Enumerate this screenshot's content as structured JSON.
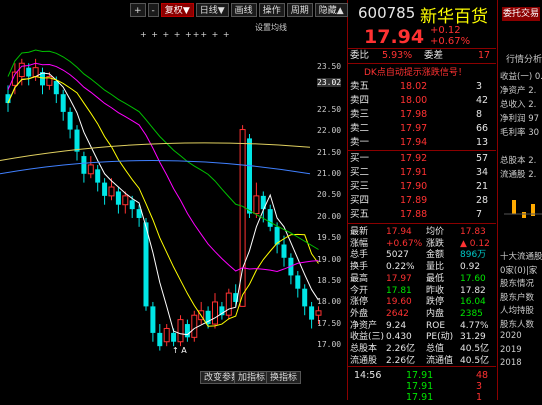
{
  "toolbar": {
    "plus": "+",
    "minus": "-",
    "adjust": "复权",
    "period": "日线",
    "overlay": "画线",
    "ops": "操作",
    "period2": "周期",
    "dropdown_arrow": "▼",
    "more": "隐藏",
    "more_arrow": "▲"
  },
  "chart": {
    "setting_label": "设置均线",
    "prices": [
      "23.50",
      "23.02",
      "22.50",
      "22.00",
      "21.50",
      "21.00",
      "20.50",
      "20.00",
      "19.50",
      "19.00",
      "18.50",
      "18.00",
      "17.50",
      "17.00"
    ],
    "buttons": [
      "改变参数",
      "加指标",
      "换指标"
    ],
    "low_label": "A",
    "markers": "+ +  + +  +++  +  +",
    "colors": {
      "up": "#ff3232",
      "down": "#00e6e6",
      "ma5": "#ffffff",
      "ma10": "#ffff00",
      "ma20": "#ff00ff",
      "ma60": "#00c000",
      "ma_long": "#4080ff"
    }
  },
  "quote": {
    "code": "600785",
    "name": "新华百货",
    "price": "17.94",
    "change": "+0.12",
    "change_pct": "+0.67%",
    "ratio_label": "委比",
    "ratio": "5.93%",
    "diff_label": "委差",
    "diff": "17",
    "signal": "DK点自动提示涨跌信号！",
    "asks": [
      {
        "label": "卖五",
        "price": "18.02",
        "vol": "3"
      },
      {
        "label": "卖四",
        "price": "18.00",
        "vol": "42"
      },
      {
        "label": "卖三",
        "price": "17.98",
        "vol": "8"
      },
      {
        "label": "卖二",
        "price": "17.97",
        "vol": "66"
      },
      {
        "label": "卖一",
        "price": "17.94",
        "vol": "13"
      }
    ],
    "bids": [
      {
        "label": "买一",
        "price": "17.92",
        "vol": "57"
      },
      {
        "label": "买二",
        "price": "17.91",
        "vol": "34"
      },
      {
        "label": "买三",
        "price": "17.90",
        "vol": "21"
      },
      {
        "label": "买四",
        "price": "17.89",
        "vol": "28"
      },
      {
        "label": "买五",
        "price": "17.88",
        "vol": "7"
      }
    ],
    "stats": [
      {
        "l1": "最新",
        "v1": "17.94",
        "c1": "red",
        "l2": "均价",
        "v2": "17.83",
        "c2": "red"
      },
      {
        "l1": "涨幅",
        "v1": "+0.67%",
        "c1": "red",
        "l2": "涨跌",
        "v2": "▲ 0.12",
        "c2": "red"
      },
      {
        "l1": "总手",
        "v1": "5027",
        "c1": "wht",
        "l2": "金额",
        "v2": "896万",
        "c2": "cyan"
      },
      {
        "l1": "换手",
        "v1": "0.22%",
        "c1": "wht",
        "l2": "量比",
        "v2": "0.92",
        "c2": "wht"
      },
      {
        "l1": "最高",
        "v1": "17.97",
        "c1": "red",
        "l2": "最低",
        "v2": "17.60",
        "c2": "grn"
      },
      {
        "l1": "今开",
        "v1": "17.81",
        "c1": "grn",
        "l2": "昨收",
        "v2": "17.82",
        "c2": "wht"
      },
      {
        "l1": "涨停",
        "v1": "19.60",
        "c1": "red",
        "l2": "跌停",
        "v2": "16.04",
        "c2": "grn"
      },
      {
        "l1": "外盘",
        "v1": "2642",
        "c1": "red",
        "l2": "内盘",
        "v2": "2385",
        "c2": "grn"
      },
      {
        "l1": "净资产",
        "v1": "9.24",
        "c1": "wht",
        "l2": "ROE",
        "v2": "4.77%",
        "c2": "wht"
      },
      {
        "l1": "收益(三)",
        "v1": "0.430",
        "c1": "wht",
        "l2": "PE(动)",
        "v2": "31.29",
        "c2": "wht"
      },
      {
        "l1": "总股本",
        "v1": "2.26亿",
        "c1": "wht",
        "l2": "总值",
        "v2": "40.5亿",
        "c2": "wht"
      },
      {
        "l1": "流通股",
        "v1": "2.26亿",
        "c1": "wht",
        "l2": "流通值",
        "v2": "40.5亿",
        "c2": "wht"
      }
    ],
    "ticks": [
      {
        "time": "14:56",
        "price": "17.91",
        "vol": "48"
      },
      {
        "time": "",
        "price": "17.91",
        "vol": "3"
      },
      {
        "time": "",
        "price": "17.91",
        "vol": "1"
      }
    ]
  },
  "info": {
    "tab": "委托交易",
    "title": "行情分析",
    "rows": [
      "收益(一)",
      "净资产",
      "总收入",
      "净利润",
      "毛利率",
      "",
      "总股本",
      "流通股",
      "",
      "",
      "",
      "",
      "十大流通股东",
      "0家(0)|家",
      "股东情况",
      "股东户数",
      "人均持股",
      "股东人数",
      "2020",
      "2019",
      "2018"
    ],
    "vals": [
      "0.",
      "2.",
      "2.",
      "97",
      "30",
      "",
      "2.",
      "2."
    ]
  }
}
